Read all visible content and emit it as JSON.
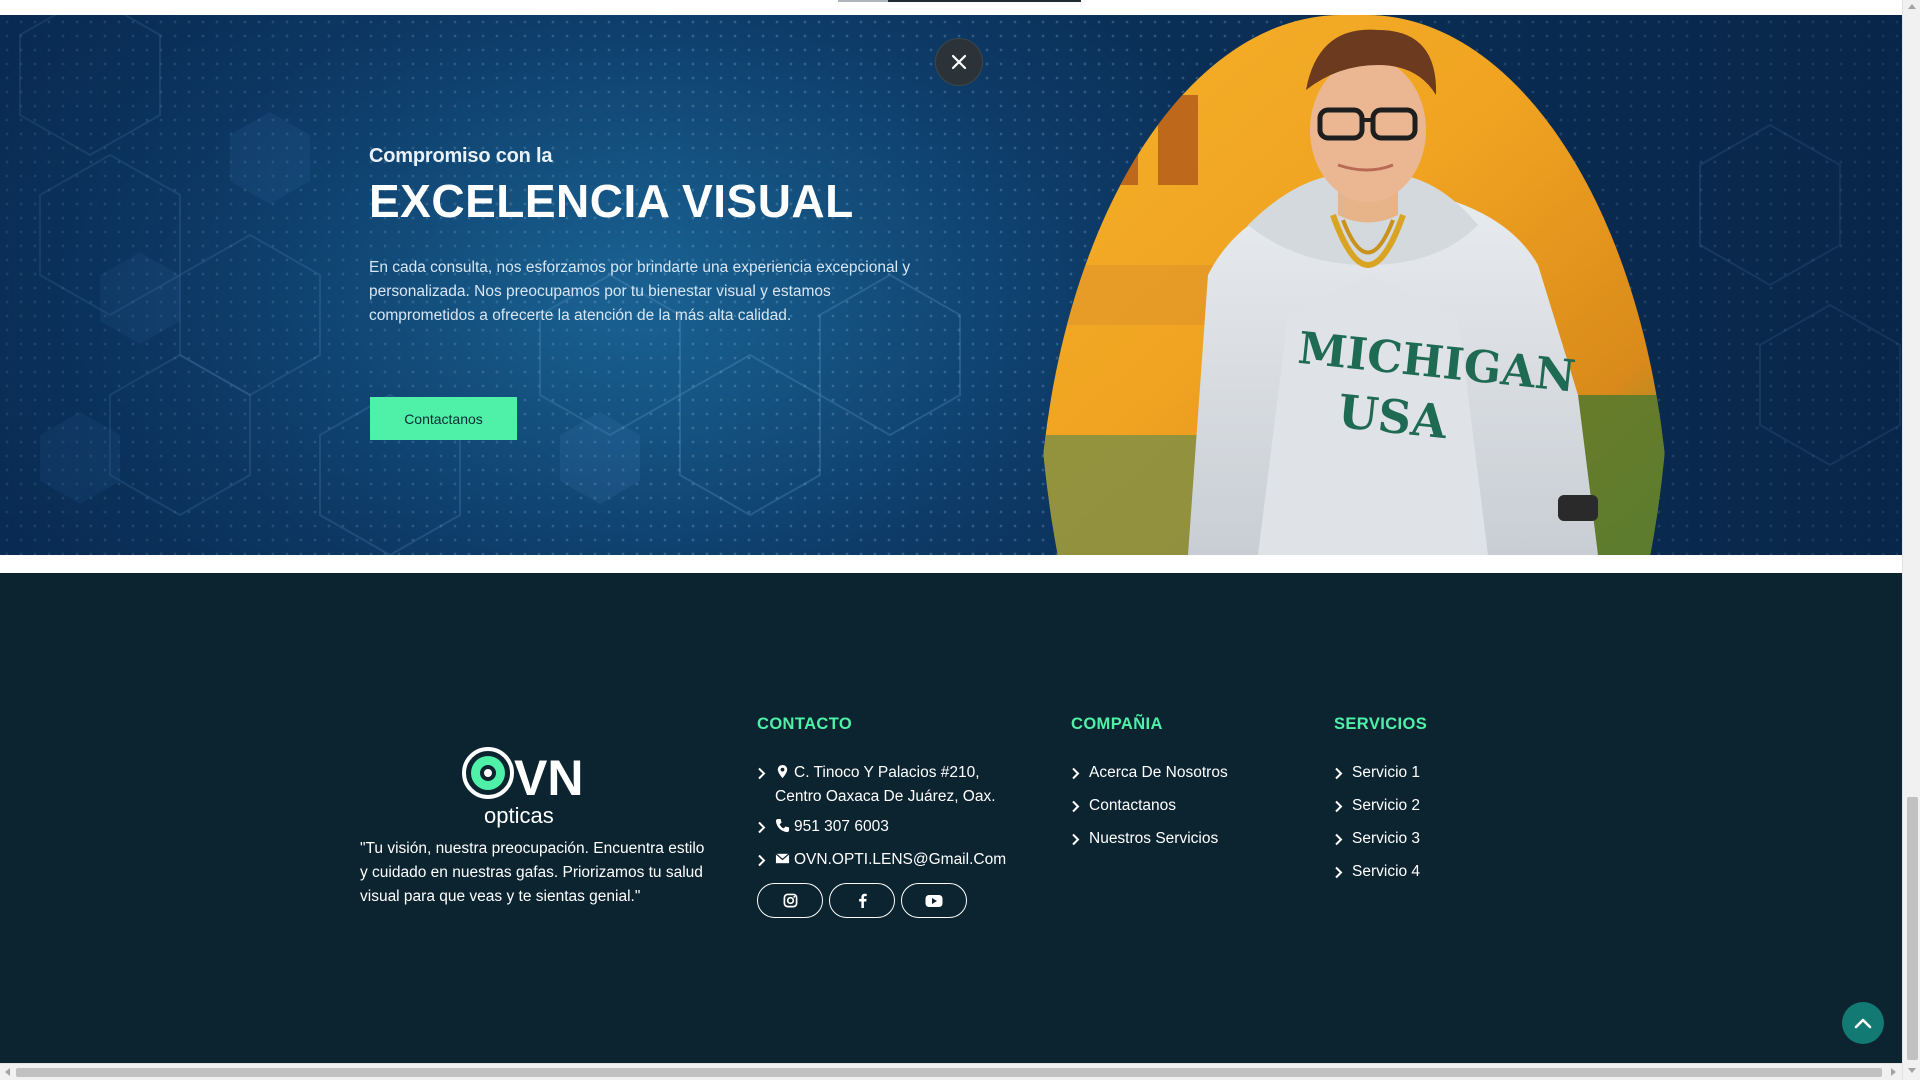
{
  "hero": {
    "kicker": "Compromiso con la",
    "title": "EXCELENCIA VISUAL",
    "body": "En cada consulta, nos esforzamos por brindarte una experiencia excepcional y personalizada. Nos preocupamos por tu bienestar visual y estamos comprometidos a ofrecerte la atención de la más alta calidad.",
    "cta_label": "Contactanos",
    "close_icon": "close-icon",
    "photo_text": "MICHIGAN USA"
  },
  "footer": {
    "logo_text": "VN",
    "logo_sub": "opticas",
    "tagline": "\"Tu visión, nuestra preocupación. Encuentra estilo y cuidado en nuestras gafas. Priorizamos tu salud visual para que veas y te sientas genial.\"",
    "contact": {
      "title": "CONTACTO",
      "address": "C. Tinoco Y Palacios #210, Centro Oaxaca De Juárez, Oax.",
      "phone": "951 307 6003",
      "email": "OVN.OPTI.LENS@Gmail.Com",
      "socials": [
        "instagram-icon",
        "facebook-icon",
        "youtube-icon"
      ]
    },
    "company": {
      "title": "COMPAÑIA",
      "items": [
        "Acerca De Nosotros",
        "Contactanos",
        "Nuestros Servicios"
      ]
    },
    "services": {
      "title": "SERVICIOS",
      "items": [
        "Servicio 1",
        "Servicio 2",
        "Servicio 3",
        "Servicio 4"
      ]
    }
  },
  "colors": {
    "accent": "#4ff0a8",
    "footer_bg": "#0c2330",
    "hero_blue": "#155585",
    "to_top": "#127a72"
  },
  "scroll_to_top_icon": "chevron-up-icon"
}
